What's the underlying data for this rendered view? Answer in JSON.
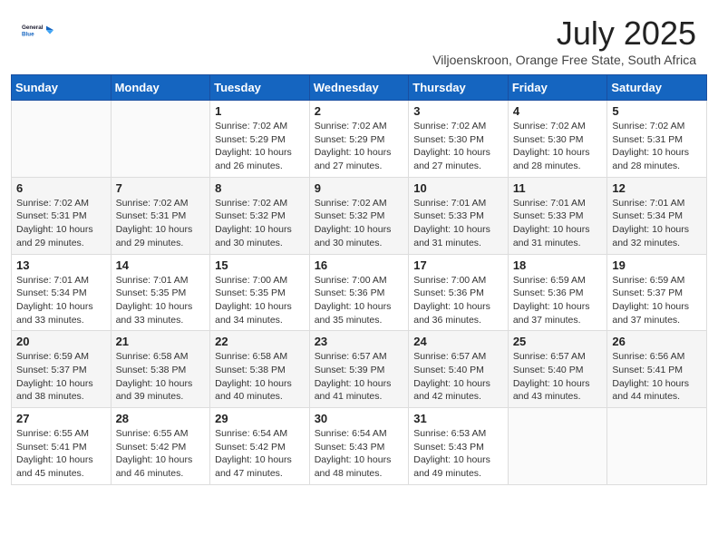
{
  "logo": {
    "line1": "General",
    "line2": "Blue"
  },
  "title": "July 2025",
  "subtitle": "Viljoenskroon, Orange Free State, South Africa",
  "days_header": [
    "Sunday",
    "Monday",
    "Tuesday",
    "Wednesday",
    "Thursday",
    "Friday",
    "Saturday"
  ],
  "weeks": [
    [
      {
        "day": "",
        "detail": ""
      },
      {
        "day": "",
        "detail": ""
      },
      {
        "day": "1",
        "detail": "Sunrise: 7:02 AM\nSunset: 5:29 PM\nDaylight: 10 hours\nand 26 minutes."
      },
      {
        "day": "2",
        "detail": "Sunrise: 7:02 AM\nSunset: 5:29 PM\nDaylight: 10 hours\nand 27 minutes."
      },
      {
        "day": "3",
        "detail": "Sunrise: 7:02 AM\nSunset: 5:30 PM\nDaylight: 10 hours\nand 27 minutes."
      },
      {
        "day": "4",
        "detail": "Sunrise: 7:02 AM\nSunset: 5:30 PM\nDaylight: 10 hours\nand 28 minutes."
      },
      {
        "day": "5",
        "detail": "Sunrise: 7:02 AM\nSunset: 5:31 PM\nDaylight: 10 hours\nand 28 minutes."
      }
    ],
    [
      {
        "day": "6",
        "detail": "Sunrise: 7:02 AM\nSunset: 5:31 PM\nDaylight: 10 hours\nand 29 minutes."
      },
      {
        "day": "7",
        "detail": "Sunrise: 7:02 AM\nSunset: 5:31 PM\nDaylight: 10 hours\nand 29 minutes."
      },
      {
        "day": "8",
        "detail": "Sunrise: 7:02 AM\nSunset: 5:32 PM\nDaylight: 10 hours\nand 30 minutes."
      },
      {
        "day": "9",
        "detail": "Sunrise: 7:02 AM\nSunset: 5:32 PM\nDaylight: 10 hours\nand 30 minutes."
      },
      {
        "day": "10",
        "detail": "Sunrise: 7:01 AM\nSunset: 5:33 PM\nDaylight: 10 hours\nand 31 minutes."
      },
      {
        "day": "11",
        "detail": "Sunrise: 7:01 AM\nSunset: 5:33 PM\nDaylight: 10 hours\nand 31 minutes."
      },
      {
        "day": "12",
        "detail": "Sunrise: 7:01 AM\nSunset: 5:34 PM\nDaylight: 10 hours\nand 32 minutes."
      }
    ],
    [
      {
        "day": "13",
        "detail": "Sunrise: 7:01 AM\nSunset: 5:34 PM\nDaylight: 10 hours\nand 33 minutes."
      },
      {
        "day": "14",
        "detail": "Sunrise: 7:01 AM\nSunset: 5:35 PM\nDaylight: 10 hours\nand 33 minutes."
      },
      {
        "day": "15",
        "detail": "Sunrise: 7:00 AM\nSunset: 5:35 PM\nDaylight: 10 hours\nand 34 minutes."
      },
      {
        "day": "16",
        "detail": "Sunrise: 7:00 AM\nSunset: 5:36 PM\nDaylight: 10 hours\nand 35 minutes."
      },
      {
        "day": "17",
        "detail": "Sunrise: 7:00 AM\nSunset: 5:36 PM\nDaylight: 10 hours\nand 36 minutes."
      },
      {
        "day": "18",
        "detail": "Sunrise: 6:59 AM\nSunset: 5:36 PM\nDaylight: 10 hours\nand 37 minutes."
      },
      {
        "day": "19",
        "detail": "Sunrise: 6:59 AM\nSunset: 5:37 PM\nDaylight: 10 hours\nand 37 minutes."
      }
    ],
    [
      {
        "day": "20",
        "detail": "Sunrise: 6:59 AM\nSunset: 5:37 PM\nDaylight: 10 hours\nand 38 minutes."
      },
      {
        "day": "21",
        "detail": "Sunrise: 6:58 AM\nSunset: 5:38 PM\nDaylight: 10 hours\nand 39 minutes."
      },
      {
        "day": "22",
        "detail": "Sunrise: 6:58 AM\nSunset: 5:38 PM\nDaylight: 10 hours\nand 40 minutes."
      },
      {
        "day": "23",
        "detail": "Sunrise: 6:57 AM\nSunset: 5:39 PM\nDaylight: 10 hours\nand 41 minutes."
      },
      {
        "day": "24",
        "detail": "Sunrise: 6:57 AM\nSunset: 5:40 PM\nDaylight: 10 hours\nand 42 minutes."
      },
      {
        "day": "25",
        "detail": "Sunrise: 6:57 AM\nSunset: 5:40 PM\nDaylight: 10 hours\nand 43 minutes."
      },
      {
        "day": "26",
        "detail": "Sunrise: 6:56 AM\nSunset: 5:41 PM\nDaylight: 10 hours\nand 44 minutes."
      }
    ],
    [
      {
        "day": "27",
        "detail": "Sunrise: 6:55 AM\nSunset: 5:41 PM\nDaylight: 10 hours\nand 45 minutes."
      },
      {
        "day": "28",
        "detail": "Sunrise: 6:55 AM\nSunset: 5:42 PM\nDaylight: 10 hours\nand 46 minutes."
      },
      {
        "day": "29",
        "detail": "Sunrise: 6:54 AM\nSunset: 5:42 PM\nDaylight: 10 hours\nand 47 minutes."
      },
      {
        "day": "30",
        "detail": "Sunrise: 6:54 AM\nSunset: 5:43 PM\nDaylight: 10 hours\nand 48 minutes."
      },
      {
        "day": "31",
        "detail": "Sunrise: 6:53 AM\nSunset: 5:43 PM\nDaylight: 10 hours\nand 49 minutes."
      },
      {
        "day": "",
        "detail": ""
      },
      {
        "day": "",
        "detail": ""
      }
    ]
  ]
}
